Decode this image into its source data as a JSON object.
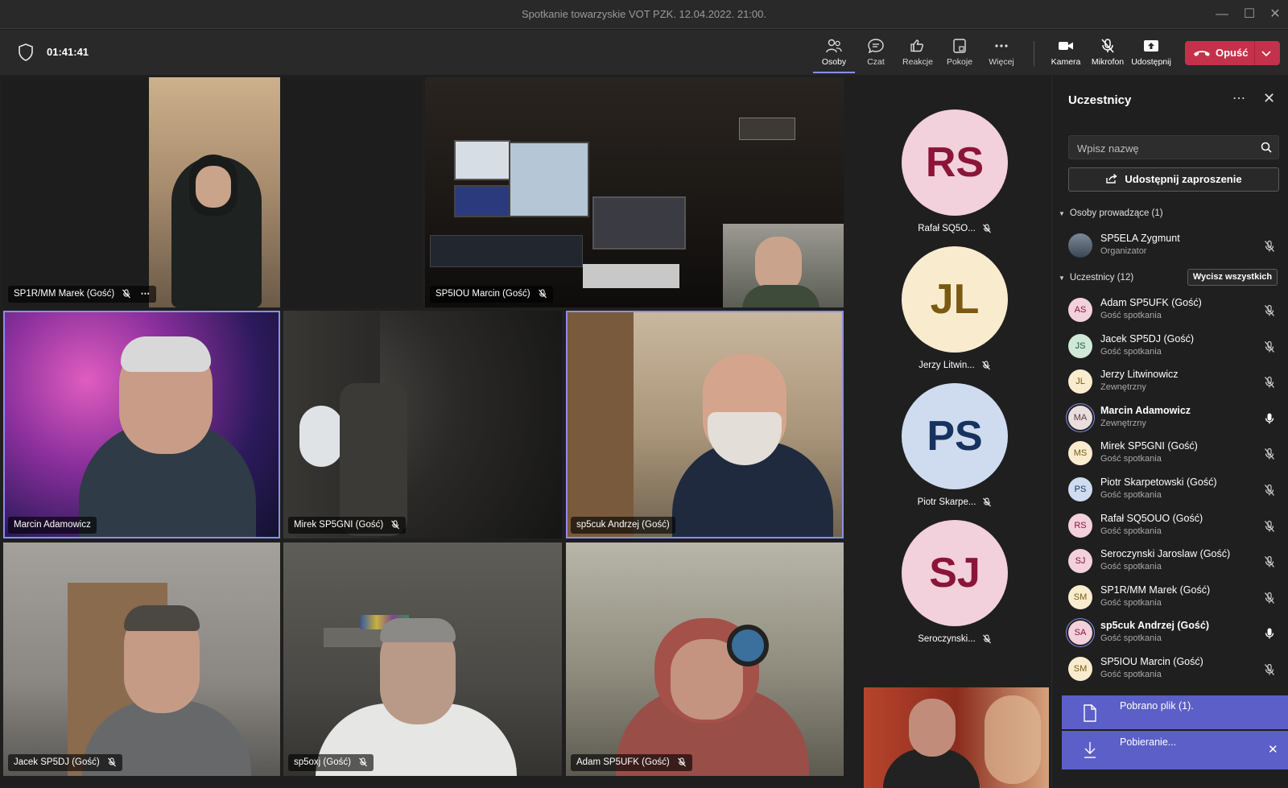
{
  "window": {
    "title": "Spotkanie towarzyskie VOT PZK. 12.04.2022. 21:00."
  },
  "toolbar": {
    "timer": "01:41:41",
    "buttons": [
      "Osoby",
      "Czat",
      "Reakcje",
      "Pokoje",
      "Więcej"
    ],
    "media": [
      "Kamera",
      "Mikrofon",
      "Udostępnij"
    ],
    "leave": "Opuść"
  },
  "tiles": [
    {
      "name": "SP1R/MM Marek (Gość)"
    },
    {
      "name": "SP5IOU Marcin (Gość)"
    },
    {
      "name": "Marcin Adamowicz"
    },
    {
      "name": "Mirek SP5GNI (Gość)"
    },
    {
      "name": "sp5cuk Andrzej (Gość)"
    },
    {
      "name": "Jacek SP5DJ (Gość)"
    },
    {
      "name": "sp5oxj (Gość)"
    },
    {
      "name": "Adam SP5UFK (Gość)"
    }
  ],
  "bubbles": [
    {
      "initials": "RS",
      "name": "Rafał SQ5O...",
      "bg": "#f2d0dc",
      "fg": "#8a1538"
    },
    {
      "initials": "JL",
      "name": "Jerzy Litwin...",
      "bg": "#f9ecce",
      "fg": "#7a5a10"
    },
    {
      "initials": "PS",
      "name": "Piotr Skarpe...",
      "bg": "#cfdcf0",
      "fg": "#17325e"
    },
    {
      "initials": "SJ",
      "name": "Seroczynski...",
      "bg": "#f2d0dc",
      "fg": "#8a1538"
    }
  ],
  "panel": {
    "title": "Uczestnicy",
    "search_placeholder": "Wpisz nazwę",
    "invite": "Udostępnij zaproszenie",
    "presenters_header": "Osoby prowadzące (1)",
    "organizer": {
      "name": "SP5ELA Zygmunt",
      "role": "Organizator"
    },
    "attendees_header": "Uczestnicy (12)",
    "mute_all": "Wycisz wszystkich",
    "attendees": [
      {
        "initials": "AS",
        "name": "Adam SP5UFK (Gość)",
        "role": "Gość spotkania",
        "bg": "#f2d0dc",
        "fg": "#8a1538",
        "muted": true,
        "speaking": false
      },
      {
        "initials": "JS",
        "name": "Jacek SP5DJ (Gość)",
        "role": "Gość spotkania",
        "bg": "#cfe8d8",
        "fg": "#1e5a35",
        "muted": true,
        "speaking": false
      },
      {
        "initials": "JL",
        "name": "Jerzy Litwinowicz",
        "role": "Zewnętrzny",
        "bg": "#f9ecce",
        "fg": "#7a5a10",
        "muted": true,
        "speaking": false
      },
      {
        "initials": "MA",
        "name": "Marcin Adamowicz",
        "role": "Zewnętrzny",
        "bg": "#e8dede",
        "fg": "#5a3a3a",
        "muted": false,
        "speaking": true
      },
      {
        "initials": "MS",
        "name": "Mirek SP5GNI (Gość)",
        "role": "Gość spotkania",
        "bg": "#f9ecce",
        "fg": "#7a5a10",
        "muted": true,
        "speaking": false
      },
      {
        "initials": "PS",
        "name": "Piotr Skarpetowski (Gość)",
        "role": "Gość spotkania",
        "bg": "#cfdcf0",
        "fg": "#17325e",
        "muted": true,
        "speaking": false
      },
      {
        "initials": "RS",
        "name": "Rafał SQ5OUO (Gość)",
        "role": "Gość spotkania",
        "bg": "#f2d0dc",
        "fg": "#8a1538",
        "muted": true,
        "speaking": false
      },
      {
        "initials": "SJ",
        "name": "Seroczynski Jaroslaw (Gość)",
        "role": "Gość spotkania",
        "bg": "#f2d0dc",
        "fg": "#8a1538",
        "muted": true,
        "speaking": false
      },
      {
        "initials": "SM",
        "name": "SP1R/MM Marek (Gość)",
        "role": "Gość spotkania",
        "bg": "#f9ecce",
        "fg": "#7a5a10",
        "muted": true,
        "speaking": false
      },
      {
        "initials": "SA",
        "name": "sp5cuk Andrzej (Gość)",
        "role": "Gość spotkania",
        "bg": "#f2d0dc",
        "fg": "#8a1538",
        "muted": false,
        "speaking": true
      },
      {
        "initials": "SM",
        "name": "SP5IOU Marcin (Gość)",
        "role": "Gość spotkania",
        "bg": "#f9ecce",
        "fg": "#7a5a10",
        "muted": true,
        "speaking": false
      }
    ]
  },
  "toasts": {
    "downloaded": "Pobrano plik (1).",
    "downloading": "Pobieranie..."
  }
}
